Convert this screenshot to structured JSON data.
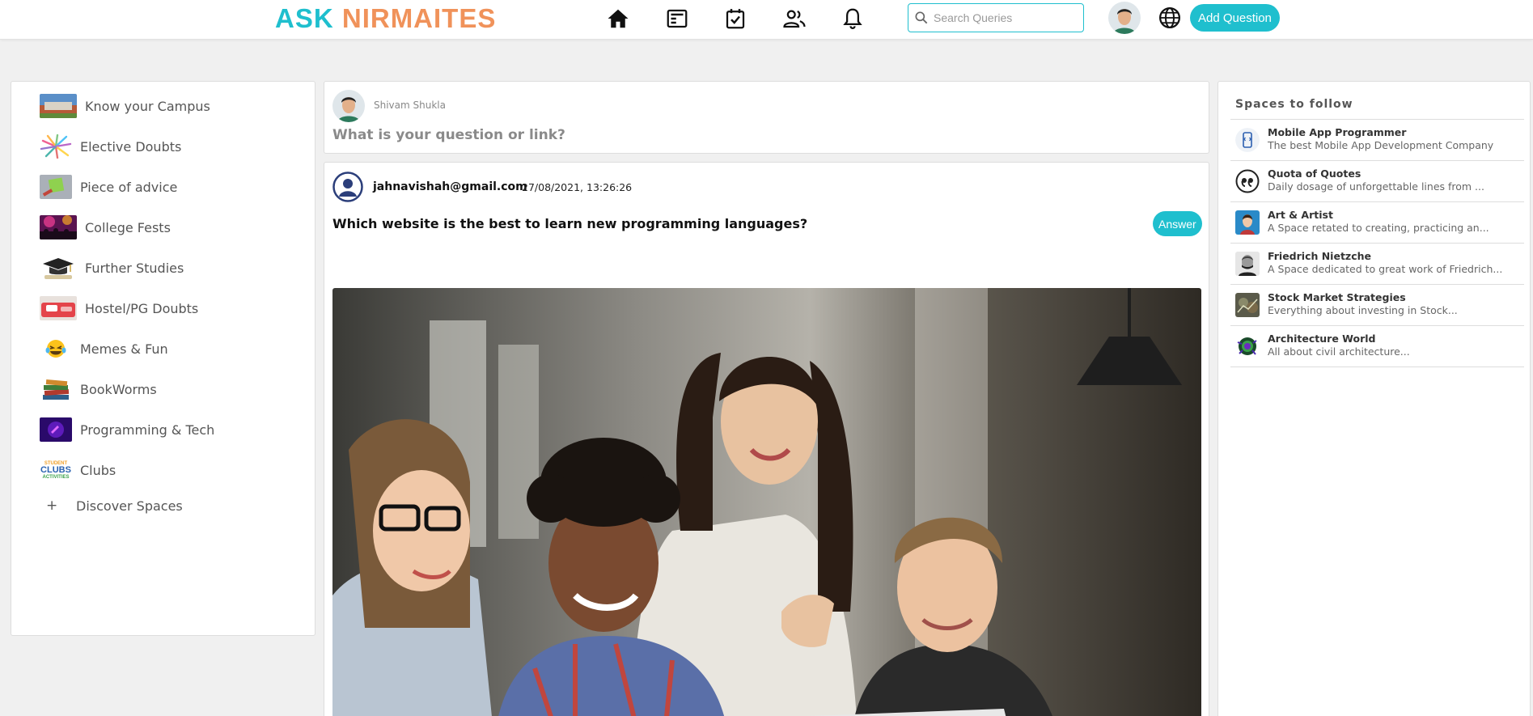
{
  "header": {
    "logo_part1": "ASK",
    "logo_part2": "NIRMAITES",
    "nav": [
      "home-icon",
      "news-feed-icon",
      "task-checklist-icon",
      "people-icon",
      "notifications-bell-icon"
    ],
    "search_placeholder": "Search Queries",
    "add_question_label": "Add Question",
    "accent_color": "#1fbfce",
    "logo_accent_color": "#f0925a"
  },
  "sidebar": {
    "items": [
      {
        "label": "Know your Campus",
        "icon": "campus-photo-icon"
      },
      {
        "label": "Elective Doubts",
        "icon": "colorful-burst-icon"
      },
      {
        "label": "Piece of advice",
        "icon": "sticky-note-icon"
      },
      {
        "label": "College Fests",
        "icon": "concert-crowd-icon"
      },
      {
        "label": "Further Studies",
        "icon": "graduation-cap-icon"
      },
      {
        "label": "Hostel/PG Doubts",
        "icon": "hostel-bed-icon"
      },
      {
        "label": "Memes & Fun",
        "icon": "laughing-emoji-icon"
      },
      {
        "label": "BookWorms",
        "icon": "book-stack-icon"
      },
      {
        "label": "Programming & Tech",
        "icon": "tech-purple-icon"
      },
      {
        "label": "Clubs",
        "icon": "student-clubs-logo-icon"
      }
    ],
    "clubs_logo_text": [
      "STUDENT",
      "CLUBS",
      "ACTIVITIES"
    ],
    "discover_label": "Discover Spaces"
  },
  "ask": {
    "user_name": "Shivam Shukla",
    "prompt": "What is your question or link?"
  },
  "post": {
    "email": "jahnavishah@gmail.com",
    "timestamp": "27/08/2021, 13:26:26",
    "question": "Which website is the best to learn new programming languages?",
    "answer_label": "Answer"
  },
  "spaces": {
    "title": "Spaces to follow",
    "items": [
      {
        "name": "Mobile App Programmer",
        "desc": "The best Mobile App Development Company",
        "icon": "mobile-app-icon"
      },
      {
        "name": "Quota of Quotes",
        "desc": "Daily dosage of unforgettable lines from ...",
        "icon": "quote-marks-icon"
      },
      {
        "name": "Art & Artist",
        "desc": "A Space retated to creating, practicing an...",
        "icon": "art-portrait-icon"
      },
      {
        "name": "Friedrich Nietzche",
        "desc": "A Space dedicated to great work of Friedrich...",
        "icon": "nietzsche-portrait-icon"
      },
      {
        "name": "Stock Market Strategies",
        "desc": "Everything about investing in Stock...",
        "icon": "stock-market-icon"
      },
      {
        "name": "Architecture World",
        "desc": "All about civil architecture...",
        "icon": "architecture-burst-icon"
      }
    ]
  }
}
